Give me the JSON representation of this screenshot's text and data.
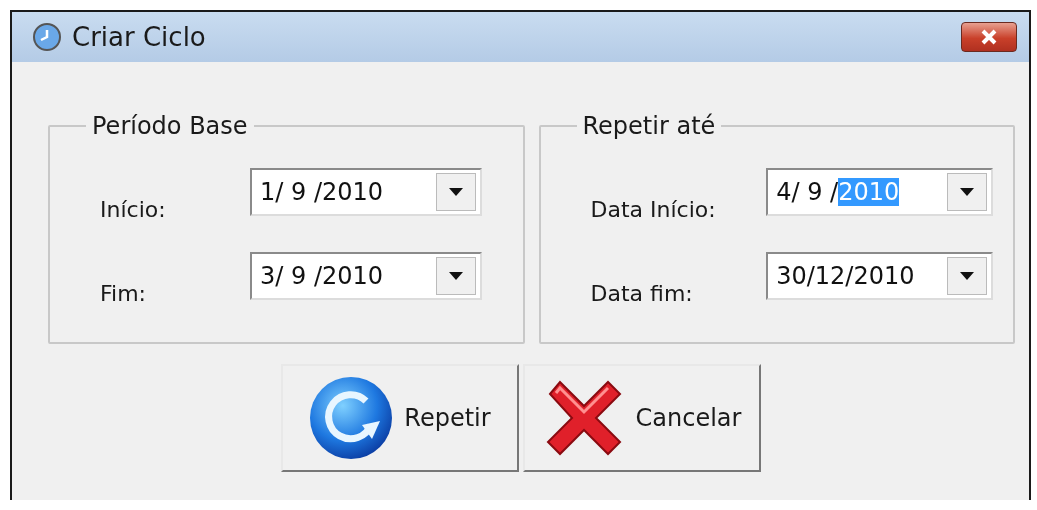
{
  "window": {
    "title": "Criar Ciclo"
  },
  "groups": [
    {
      "title": "Período Base",
      "fields": [
        {
          "label": "Início:",
          "value": "1/ 9 /2010"
        },
        {
          "label": "Fim:",
          "value": "3/ 9 /2010"
        }
      ]
    },
    {
      "title": "Repetir até",
      "fields": [
        {
          "label": "Data Início:",
          "value": "4/ 9 /",
          "selected_text": "2010"
        },
        {
          "label": "Data fim:",
          "value": "30/12/2010"
        }
      ]
    }
  ],
  "buttons": [
    {
      "kind": "repeat",
      "label": "Repetir"
    },
    {
      "kind": "cancel",
      "label": "Cancelar"
    }
  ]
}
